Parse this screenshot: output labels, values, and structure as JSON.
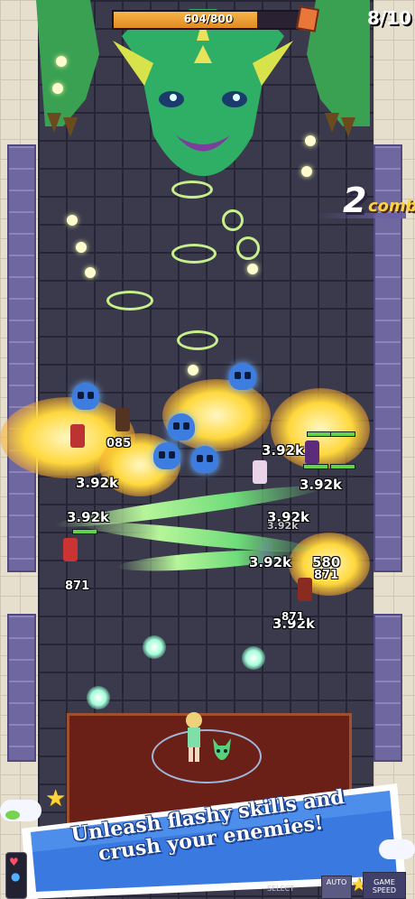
{
  "boss": {
    "hp_text": "604/800",
    "hp_fraction": 0.755
  },
  "wave": {
    "counter": "8/10"
  },
  "combo": {
    "count": "2",
    "label": "combo"
  },
  "damage_numbers": [
    "3.92k",
    "3.92k",
    "3.92k",
    "3.92k",
    "3.92k",
    "3.92k",
    "3.92k",
    "3.92k",
    "580",
    "871",
    "871",
    "871",
    "085"
  ],
  "banner": {
    "line1": "Unleash flashy skills and",
    "line2": "crush your enemies!"
  },
  "controls": {
    "auto_select": "SELECT",
    "auto": "AUTO",
    "game_speed_1": "GAME",
    "game_speed_2": "SPEED"
  },
  "colors": {
    "boss_hp": "#e08a23",
    "floor": "#3b3a4d",
    "carpet": "#6a1f17",
    "banner": "#3a7ae0",
    "combo_word": "#ffd23b"
  }
}
